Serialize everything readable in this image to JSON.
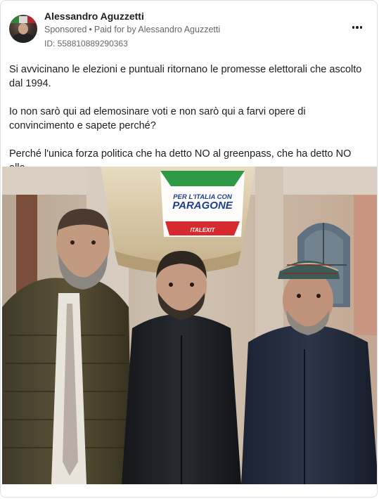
{
  "post": {
    "author": "Alessandro Aguzzetti",
    "sponsored_label": "Sponsored",
    "separator": "•",
    "paid_for_by": "Paid for by Alessandro Aguzzetti",
    "id_label": "ID: 558810889290363",
    "more_icon": "more-horizontal-icon",
    "paragraphs": [
      "Si avvicinano le elezioni e puntuali ritornano le promesse elettorali che ascolto dal 1994.",
      "Io non sarò qui ad elemosinare voti e non sarò qui a farvi opere di convincimento e sapete perché?",
      "Perché l'unica forza politica che ha detto NO al greenpass, che ha detto NO alle..."
    ]
  },
  "photo": {
    "banner_line1": "PER L'ITALIA CON",
    "banner_line2": "PARAGONE",
    "banner_logo": "ITALEXIT",
    "colors": {
      "banner_green": "#2f9a45",
      "banner_red": "#d62a2f",
      "banner_blue": "#1c3f8f"
    }
  }
}
